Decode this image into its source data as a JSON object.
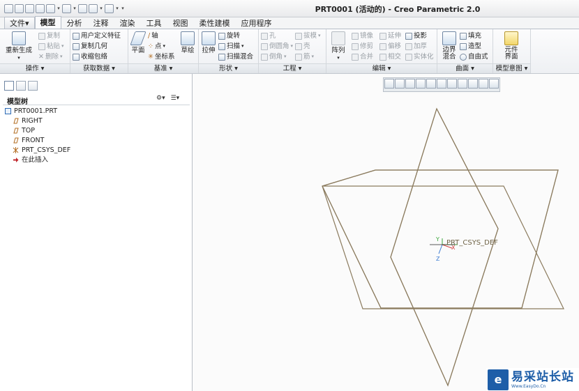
{
  "window": {
    "title": "PRT0001 (活动的) - Creo Parametric 2.0"
  },
  "tabs": [
    "文件",
    "模型",
    "分析",
    "注释",
    "渲染",
    "工具",
    "视图",
    "柔性建模",
    "应用程序"
  ],
  "active_tab": "模型",
  "ribbon": {
    "operations": {
      "label": "操作",
      "regen": "重新生成",
      "copy": "复制",
      "paste": "粘贴",
      "delete": "删除"
    },
    "get_data": {
      "label": "获取数据",
      "udf": "用户定义特征",
      "copy_geom": "复制几何",
      "shrinkwrap": "收缩包络"
    },
    "datum": {
      "label": "基准",
      "plane": "平面",
      "axis": "轴",
      "point": "点",
      "csys": "坐标系",
      "sketch": "草绘"
    },
    "shapes": {
      "label": "形状",
      "extrude": "拉伸",
      "revolve": "旋转",
      "sweep": "扫描",
      "swept_blend": "扫描混合"
    },
    "engineering": {
      "label": "工程",
      "hole": "孔",
      "round": "倒圆角",
      "chamfer": "倒角",
      "draft": "拔模",
      "shell": "壳",
      "rib": "筋"
    },
    "editing": {
      "label": "编辑",
      "pattern": "阵列",
      "mirror": "镜像",
      "trim": "修剪",
      "merge": "合并",
      "extend": "延伸",
      "offset": "偏移",
      "intersect": "相交",
      "project": "投影",
      "thicken": "加厚",
      "solidify": "实体化"
    },
    "surfaces": {
      "label": "曲面",
      "boundary_blend": "边界混合",
      "fill": "填充",
      "style": "造型",
      "freestyle": "自由式"
    },
    "model_intent": {
      "label": "模型意图",
      "component_interface": "元件界面"
    }
  },
  "model_tree": {
    "title": "模型树",
    "items": [
      "PRT0001.PRT",
      "RIGHT",
      "TOP",
      "FRONT",
      "PRT_CSYS_DEF",
      "在此插入"
    ]
  },
  "viewport": {
    "csys_label": "PRT_CSYS_DEF",
    "axis_labels": [
      "X",
      "Y",
      "Z"
    ]
  },
  "watermark": {
    "cn": "易采站长站",
    "en": "Www.EasyDo.Cn"
  },
  "colors": {
    "datum_plane": "#8b7b5e",
    "csys_x": "#d23a3a",
    "csys_y": "#3aa43a",
    "csys_z": "#3a7ad2",
    "insert_arrow": "#c0282d"
  }
}
